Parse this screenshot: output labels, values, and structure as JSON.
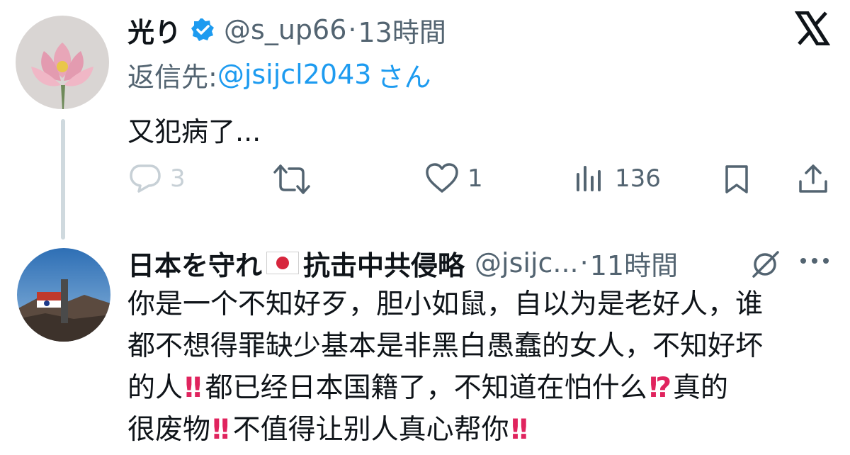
{
  "tweet1": {
    "display_name": "光り",
    "handle": "@s_up66",
    "separator": "·",
    "time": "13時間",
    "reply_prefix": "返信先: ",
    "reply_handle": "@jsijcl2043",
    "reply_suffix": "さん",
    "text": "又犯病了...",
    "actions": {
      "replies": "3",
      "retweets": "",
      "likes": "1",
      "views": "136"
    },
    "verified": true
  },
  "tweet2": {
    "display_name_a": "日本を守れ",
    "display_name_b": "抗击中共侵略",
    "handle": "@jsijc...",
    "separator": "·",
    "time": "11時間",
    "line1": "你是一个不知好歹，胆小如鼠，自以为是老好人，谁",
    "line2": "都不想得罪缺少基本是非黑白愚蠢的女人，不知好坏",
    "line3a": "的人",
    "line3b": "都已经日本国籍了，不知道在怕什么",
    "line3c": "真的",
    "line4a": "很废物",
    "line4b": "不值得让别人真心帮你",
    "bang": "!!",
    "interrobang": "!?"
  },
  "header": {
    "logo": "X",
    "more": "···"
  },
  "colors": {
    "accent": "#1d9bf0",
    "text": "#0f1419",
    "secondary": "#536471",
    "emoji_red": "#e0245e"
  }
}
